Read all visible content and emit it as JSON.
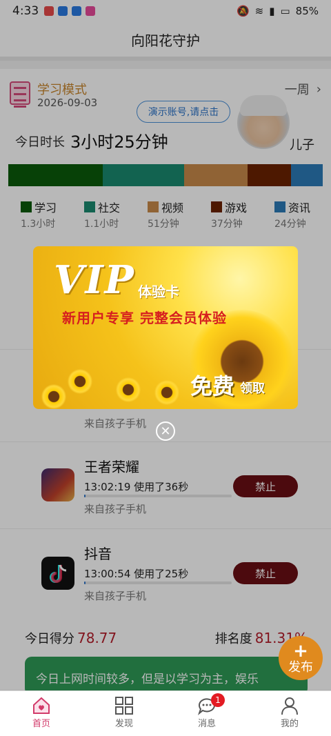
{
  "statusbar": {
    "time": "4:33",
    "battery": "85%"
  },
  "header": {
    "title": "向阳花守护"
  },
  "mode": {
    "title": "学习模式",
    "date": "2026-09-03",
    "range": "一周"
  },
  "demo": {
    "hint": "演示账号,请点击"
  },
  "child": {
    "label": "儿子"
  },
  "today": {
    "label": "今日时长",
    "value": "3小时25分钟"
  },
  "usage_bar": [
    {
      "name": "学习",
      "color": "#0a5a0a",
      "fraction": 0.3
    },
    {
      "name": "社交",
      "color": "#1a8a70",
      "fraction": 0.26
    },
    {
      "name": "视频",
      "color": "#c8894a",
      "fraction": 0.2
    },
    {
      "name": "游戏",
      "color": "#6b2200",
      "fraction": 0.14
    },
    {
      "name": "资讯",
      "color": "#2c7ab8",
      "fraction": 0.1
    }
  ],
  "legend": [
    {
      "name": "学习",
      "amount": "1.3小时",
      "color": "#0a5a0a"
    },
    {
      "name": "社交",
      "amount": "1.1小时",
      "color": "#1a8a70"
    },
    {
      "name": "视频",
      "amount": "51分钟",
      "color": "#c8894a"
    },
    {
      "name": "游戏",
      "amount": "37分钟",
      "color": "#6b2200"
    },
    {
      "name": "资讯",
      "amount": "24分钟",
      "color": "#2c7ab8"
    }
  ],
  "apps": [
    {
      "name": "",
      "time": "",
      "source": "来自孩子手机",
      "action": ""
    },
    {
      "name": "王者荣耀",
      "time": "13:02:19 使用了36秒",
      "source": "来自孩子手机",
      "action": "禁止",
      "progress": 0.01
    },
    {
      "name": "抖音",
      "time": "13:00:54 使用了25秒",
      "source": "来自孩子手机",
      "action": "禁止",
      "progress": 0.01
    }
  ],
  "score": {
    "today_label": "今日得分",
    "today_value": "78.77",
    "rank_label": "排名度",
    "rank_value": "81.31%"
  },
  "tip": {
    "text": "今日上网时间较多，但是以学习为主，娱乐"
  },
  "fab": {
    "plus": "+",
    "label": "发布"
  },
  "tabs": [
    {
      "label": "首页",
      "icon": "home-icon"
    },
    {
      "label": "发现",
      "icon": "grid-icon"
    },
    {
      "label": "消息",
      "icon": "chat-icon",
      "badge": "1"
    },
    {
      "label": "我的",
      "icon": "user-icon"
    }
  ],
  "vip": {
    "title": "VIP",
    "subtitle": "体验卡",
    "slogan": "新用户专享  完整会员体验",
    "free": "免费",
    "claim": "领取"
  },
  "close": {
    "symbol": "✕"
  }
}
